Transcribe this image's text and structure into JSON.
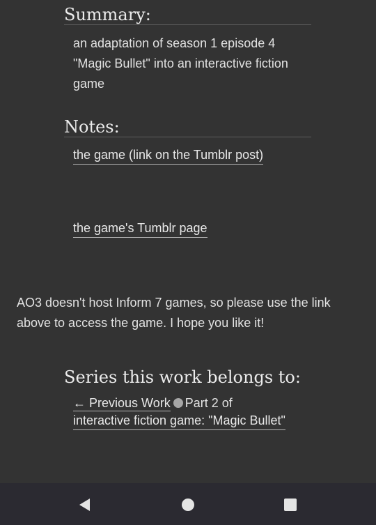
{
  "summary": {
    "heading": "Summary:",
    "text": "an adaptation of season 1 episode 4 \"Magic Bullet\" into an interactive fiction game"
  },
  "notes": {
    "heading": "Notes:",
    "links": [
      "the game (link on the Tumblr post)",
      "the game's Tumblr page"
    ]
  },
  "end_note": "AO3 doesn't host Inform 7 games, so please use the link above to access the game. I hope you like it!",
  "series": {
    "heading": "Series this work belongs to:",
    "previous_label": "← Previous Work",
    "part_text": "Part 2 of",
    "series_title": "interactive fiction game: \"Magic Bullet\""
  },
  "navbar": {
    "icons": [
      "back-icon",
      "home-icon",
      "recents-icon"
    ],
    "icon_color": "#e4e4e4"
  }
}
